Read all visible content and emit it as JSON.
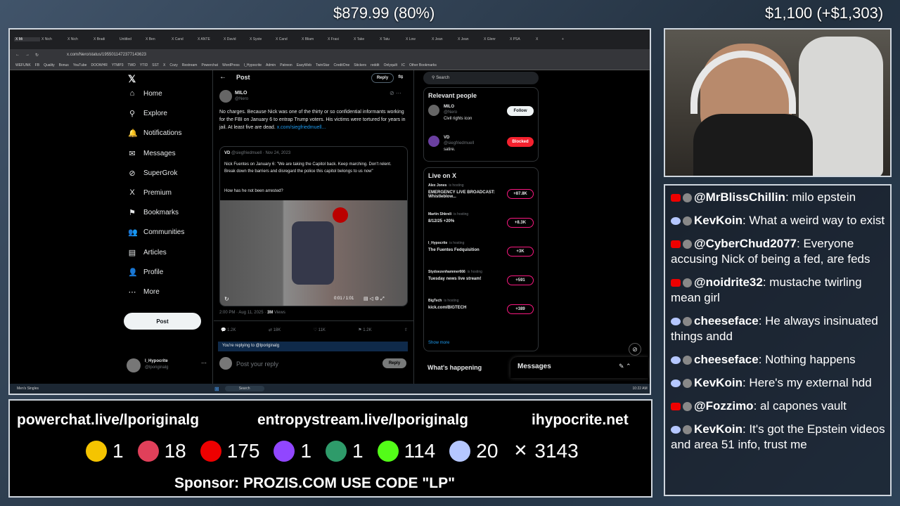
{
  "overlay": {
    "left_price": "$879.99 (80%)",
    "right_price": "$1,100 (+$1,303)"
  },
  "browser": {
    "tabs": [
      "X Mi",
      "X Nich",
      "X Nich",
      "X Bradi",
      "Untitled",
      "X Ben",
      "X Cand",
      "X ANTE",
      "X David",
      "X Syste",
      "X Cand",
      "X Bliam",
      "X Frasi",
      "X Take",
      "X Tatu",
      "X Low",
      "X Jean",
      "X Jean",
      "X Glenr",
      "X PSA",
      "X",
      "+"
    ],
    "url": "x.com/Nero/status/1955011472377143623",
    "bookmarks": [
      "WEFUNK",
      "FB",
      "Quality",
      "Bonus",
      "YouTube",
      "DOOWHR",
      "YTMP3",
      "TWD",
      "YTID",
      "SST",
      "X",
      "Cozy",
      "Restream",
      "Powerchat",
      "WordPress",
      "I_Hypocrite",
      "Admin",
      "Patreon",
      "EasyWeb",
      "TwinStar",
      "CreditOne",
      "Stickers",
      "reddit",
      "Onlyquilt",
      "IC",
      "Other Bookmarks"
    ]
  },
  "nav": {
    "items": [
      {
        "label": "Home",
        "icon": "⌂"
      },
      {
        "label": "Explore",
        "icon": "⚲"
      },
      {
        "label": "Notifications",
        "icon": "🔔"
      },
      {
        "label": "Messages",
        "icon": "✉"
      },
      {
        "label": "SuperGrok",
        "icon": "⊘"
      },
      {
        "label": "Premium",
        "icon": "X"
      },
      {
        "label": "Bookmarks",
        "icon": "⚑"
      },
      {
        "label": "Communities",
        "icon": "👥"
      },
      {
        "label": "Articles",
        "icon": "▤"
      },
      {
        "label": "Profile",
        "icon": "👤"
      },
      {
        "label": "More",
        "icon": "⋯"
      }
    ],
    "post_label": "Post",
    "account_name": "I_Hypocrite",
    "account_handle": "@lporiginalg"
  },
  "post": {
    "header": "Post",
    "reply_btn": "Reply",
    "author": "MILO",
    "handle": "@Nero",
    "text": "No charges. Because Nick was one of the thirty or so confidential informants working for the FBI on January 6 to entrap Trump voters. His victims were tortured for years in jail. At least five are dead.",
    "link": "x.com/siegfriedmuell...",
    "quote_author": "VD",
    "quote_handle": "@siegfriedmuell",
    "quote_date": "Nov 24, 2023",
    "quote_text": "Nick Fuentes on January 6: \"We are taking the Capitol back.  Keep marching. Don't relent.  Break down the barriers and disregard the police this capitol belongs to us now\"",
    "quote_question": "How has he not been arrested?",
    "video_time": "0:01 / 1:01",
    "meta": "2:00 PM · Aug 11, 2025 · ",
    "views": "3M",
    "views_label": "Views",
    "stats": [
      "1.2K",
      "18K",
      "11K",
      "1.2K"
    ],
    "replying": "You're replying to @lporiginalg",
    "reply_placeholder": "Post your reply",
    "reply_button": "Reply"
  },
  "right": {
    "search": "Search",
    "relevant_title": "Relevant people",
    "people": [
      {
        "name": "MILO",
        "handle": "@Nero",
        "bio": "Civil rights icon",
        "btn": "Follow"
      },
      {
        "name": "VD",
        "handle": "@siegfriedmuell",
        "bio": "satire.",
        "btn": "Blocked"
      }
    ],
    "live_title": "Live on X",
    "live": [
      {
        "host": "Alex Jones",
        "title": "EMERGENCY LIVE BROADCAST: Whistleblow...",
        "count": "+87.8K"
      },
      {
        "host": "Martin Shkreli",
        "title": "8/12/25 +20%",
        "count": "+8.3K"
      },
      {
        "host": "I_Hypocrite",
        "title": "The Fuentes Fedquisition",
        "count": "+3K"
      },
      {
        "host": "Stydoezenhammer666",
        "title": "Tuesday news live stream!",
        "count": "+591"
      },
      {
        "host": "BigTech",
        "title": "kick.com/BIGTECH",
        "count": "+389"
      }
    ],
    "hosting": "is hosting",
    "show_more": "Show more",
    "happening": "What's happening",
    "messages": "Messages"
  },
  "chat": [
    {
      "user": "@MrBlissChillin",
      "text": "milo epstein",
      "platform": "yt"
    },
    {
      "user": "KevKoin",
      "text": "What a weird way to exist",
      "platform": "kick"
    },
    {
      "user": "@CyberChud2077",
      "text": "Everyone accusing Nick of being a fed, are feds",
      "platform": "yt"
    },
    {
      "user": "@noidrite32",
      "text": "mustache twirling mean girl",
      "platform": "yt"
    },
    {
      "user": "cheeseface",
      "text": "He always insinuated things andd",
      "platform": "kick"
    },
    {
      "user": "cheeseface",
      "text": "Nothing happens",
      "platform": "kick"
    },
    {
      "user": "KevKoin",
      "text": "Here's my external hdd",
      "platform": "kick"
    },
    {
      "user": "@Fozzimo",
      "text": "al capones vault",
      "platform": "yt"
    },
    {
      "user": "KevKoin",
      "text": "It's got the Epstein videos and area 51 info, trust me",
      "platform": "kick"
    }
  ],
  "footer": {
    "urls": [
      "powerchat.live/lporiginalg",
      "entropystream.live/lporiginalg",
      "ihypocrite.net"
    ],
    "stats": [
      {
        "icon": "rumble-icon",
        "count": "1",
        "color": "#f5c400"
      },
      {
        "icon": "pinwheel-icon",
        "count": "18",
        "color": "#e0405a"
      },
      {
        "icon": "youtube-icon",
        "count": "175",
        "color": "#e00"
      },
      {
        "icon": "twitch-icon",
        "count": "1",
        "color": "#9146ff"
      },
      {
        "icon": "orb-icon",
        "count": "1",
        "color": "#2e9b6a"
      },
      {
        "icon": "kick-icon",
        "count": "114",
        "color": "#53fc18"
      },
      {
        "icon": "moon-icon",
        "count": "20",
        "color": "#b5c7ff"
      },
      {
        "icon": "x-icon",
        "count": "3143",
        "color": "#000"
      }
    ],
    "sponsor": "Sponsor: PROZIS.COM USE CODE \"LP\""
  }
}
